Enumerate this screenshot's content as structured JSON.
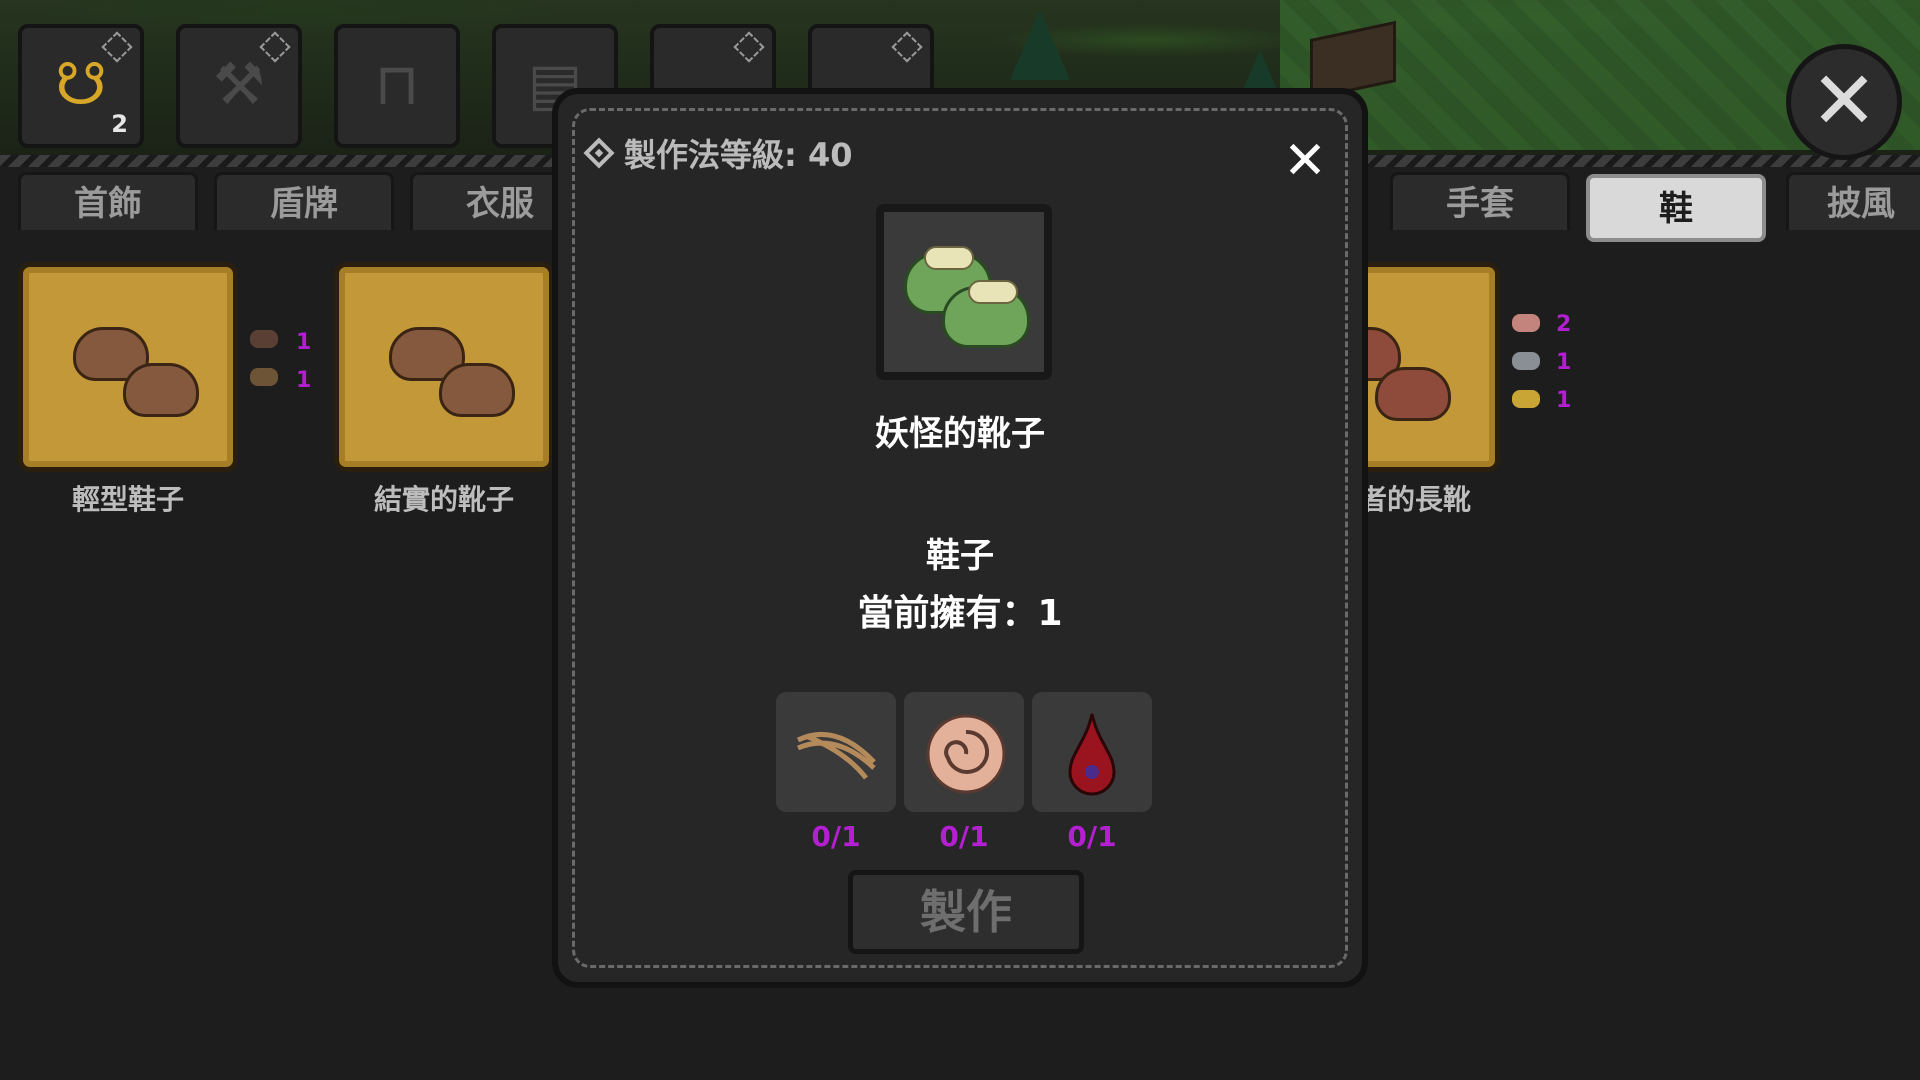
{
  "top_categories": [
    {
      "icon": "necklace-icon",
      "count": "2",
      "active": true
    },
    {
      "icon": "axe-icon",
      "count": "",
      "active": false
    },
    {
      "icon": "workbench-icon",
      "count": "",
      "active": false
    },
    {
      "icon": "crate-icon",
      "count": "",
      "active": false
    },
    {
      "icon": "anvil-icon",
      "count": "",
      "active": false
    },
    {
      "icon": "horse-icon",
      "count": "",
      "active": false
    }
  ],
  "tabs": [
    {
      "label": "首飾",
      "active": false
    },
    {
      "label": "盾牌",
      "active": false
    },
    {
      "label": "衣服",
      "active": false
    },
    {
      "label": "手套",
      "active": false
    },
    {
      "label": "鞋",
      "active": true
    },
    {
      "label": "披風",
      "active": false
    }
  ],
  "items": [
    {
      "name": "輕型鞋子",
      "reqs": [
        "1",
        "1"
      ]
    },
    {
      "name": "結實的靴子",
      "reqs": []
    },
    {
      "name": "者的長靴",
      "reqs": [
        "2",
        "1",
        "1"
      ]
    }
  ],
  "modal": {
    "level_label": "製作法等級: 40",
    "close_glyph": "✕",
    "item_name": "妖怪的靴子",
    "item_type": "鞋子",
    "owned_label": "當前擁有：1",
    "ingredients": [
      {
        "icon": "rope-icon",
        "count": "0/1"
      },
      {
        "icon": "coiled-worm-icon",
        "count": "0/1"
      },
      {
        "icon": "blood-drop-icon",
        "count": "0/1"
      }
    ],
    "craft_label": "製作"
  },
  "colors": {
    "accent_purple": "#b41fd2",
    "card_gold": "#c29838",
    "modal_bg": "#262626"
  }
}
